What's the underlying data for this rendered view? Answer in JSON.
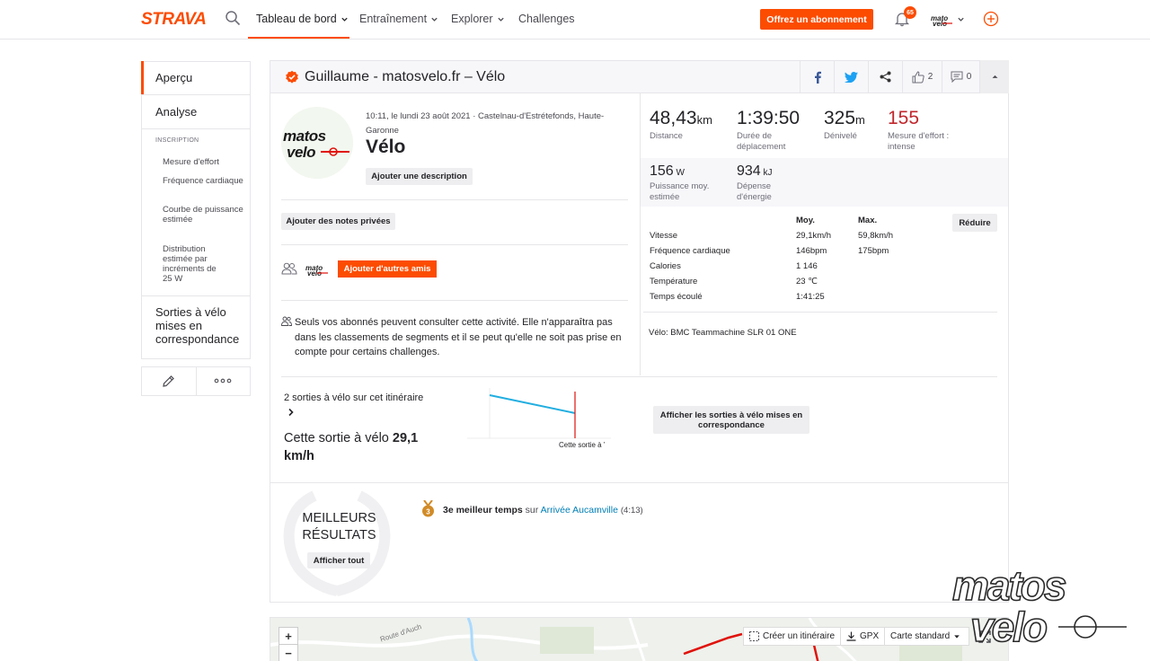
{
  "nav": {
    "logo": "STRAVA",
    "items": [
      {
        "label": "Tableau de bord"
      },
      {
        "label": "Entraînement"
      },
      {
        "label": "Explorer"
      },
      {
        "label": "Challenges"
      }
    ],
    "subscribe_label": "Offrez un abonnement",
    "notification_count": "65",
    "accent_color": "#fc4c02"
  },
  "sidebar": {
    "items": [
      {
        "label": "Aperçu"
      },
      {
        "label": "Analyse"
      }
    ],
    "section_label": "INSCRIPTION",
    "subitems": [
      {
        "label": "Mesure d'effort"
      },
      {
        "label": "Fréquence cardiaque"
      },
      {
        "label": "Courbe de puissance estimée"
      },
      {
        "label": "Distribution estimée par incréments de 25 W"
      }
    ],
    "matched_label": "Sorties à vélo mises en correspondance",
    "edit_icon": "pencil-icon",
    "more_icon": "more-dots-icon"
  },
  "activity": {
    "title": "Guillaume - matosvelo.fr – Vélo",
    "datetime": "10:11, le lundi 23 août 2021 · Castelnau-d'Estrétefonds, Haute-Garonne",
    "name": "Vélo",
    "add_description": "Ajouter une description",
    "add_private_notes": "Ajouter des notes privées",
    "add_friends": "Ajouter d'autres amis",
    "privacy_text": "Seuls vos abonnés peuvent consulter cette activité. Elle n'apparaîtra pas dans les classements de segments et il se peut qu'elle ne soit pas prise en compte pour certains challenges.",
    "kudos_count": "2",
    "comment_count": "0"
  },
  "stats": {
    "primary": [
      {
        "value": "48,43",
        "unit": "km",
        "label": "Distance"
      },
      {
        "value": "1:39:50",
        "unit": "",
        "label": "Durée de déplacement"
      },
      {
        "value": "325",
        "unit": "m",
        "label": "Dénivelé"
      },
      {
        "value": "155",
        "unit": "",
        "label": "Mesure d'effort : intense"
      }
    ],
    "secondary": [
      {
        "value": "156",
        "unit": "W",
        "label": "Puissance moy. estimée"
      },
      {
        "value": "934",
        "unit": "kJ",
        "label": "Dépense d'énergie"
      }
    ],
    "effort_color": "#c0272d",
    "table": {
      "headers": [
        "Moy.",
        "Max."
      ],
      "rows": [
        {
          "label": "Vitesse",
          "avg": "29,1km/h",
          "max": "59,8km/h"
        },
        {
          "label": "Fréquence cardiaque",
          "avg": "146bpm",
          "max": "175bpm"
        },
        {
          "label": "Calories",
          "avg": "1 146",
          "max": ""
        },
        {
          "label": "Température",
          "avg": "23 ℃",
          "max": ""
        },
        {
          "label": "Temps écoulé",
          "avg": "1:41:25",
          "max": ""
        }
      ],
      "reduce_label": "Réduire"
    },
    "bike": "Vélo: BMC Teammachine SLR 01 ONE"
  },
  "matched": {
    "count_text": "2 sorties à vélo sur cet itinéraire",
    "this_ride_prefix": "Cette sortie à vélo",
    "this_ride_speed": "29,1 km/h",
    "chart_label": "Cette sortie à ’",
    "button_label": "Afficher les sorties à vélo mises en correspondance"
  },
  "best": {
    "title": "MEILLEURS RÉSULTATS",
    "show_all": "Afficher tout",
    "medal_rank": "3",
    "segment_rank": "3e meilleur temps",
    "segment_prep": "sur",
    "segment_name": "Arrivée Aucamville",
    "segment_time": "(4:13)"
  },
  "map": {
    "zoom_in": "+",
    "zoom_out": "−",
    "road_label": "Route d'Auch",
    "create_route": "Créer un itinéraire",
    "gpx": "GPX",
    "map_type": "Carte standard",
    "route_color": "#e0120b"
  }
}
